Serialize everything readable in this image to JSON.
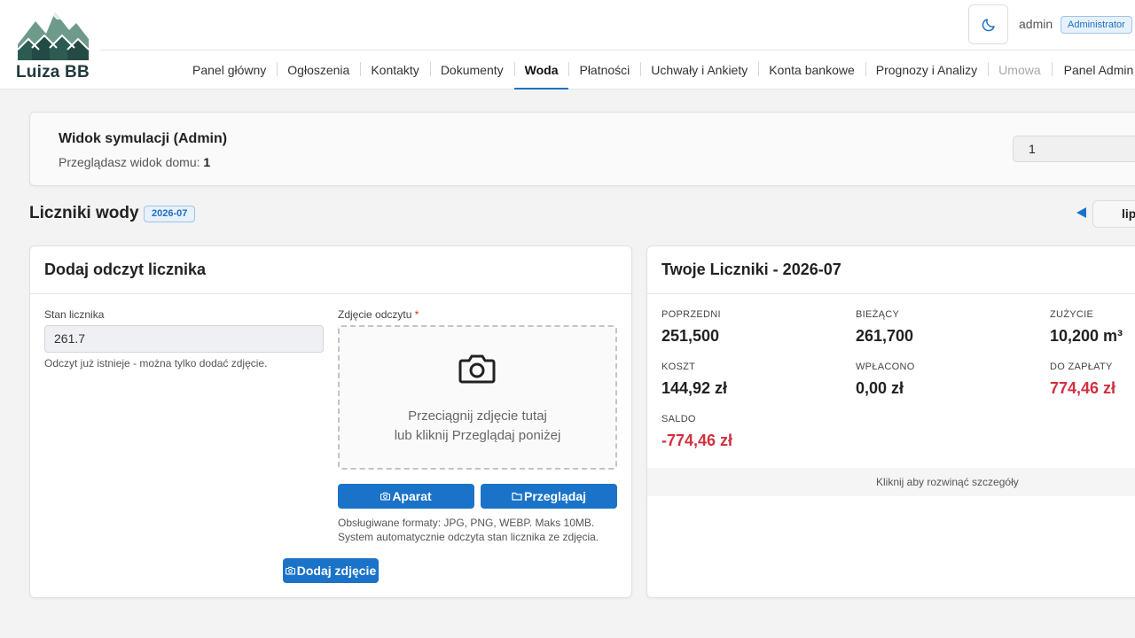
{
  "app": {
    "logo_text": "Luiza BB",
    "logo_icon": "mountain-houses-logo"
  },
  "header": {
    "theme_icon": "moon-icon",
    "user_name": "admin",
    "role_badge": "Administrator"
  },
  "nav": {
    "items": [
      {
        "label": "Panel główny"
      },
      {
        "label": "Ogłoszenia"
      },
      {
        "label": "Kontakty"
      },
      {
        "label": "Dokumenty"
      },
      {
        "label": "Woda",
        "active": true
      },
      {
        "label": "Płatności"
      },
      {
        "label": "Uchwały i Ankiety"
      },
      {
        "label": "Konta bankowe"
      },
      {
        "label": "Prognozy i Analizy"
      },
      {
        "label": "Umowa",
        "disabled": true
      },
      {
        "label": "Panel Admin"
      }
    ]
  },
  "simulation": {
    "title": "Widok symulacji (Admin)",
    "subtitle_prefix": "Przeglądasz widok domu:",
    "house": "1",
    "select_value": "1"
  },
  "section": {
    "title": "Liczniki wody",
    "month_badge": "2026-07",
    "prev_icon": "triangle-left-icon",
    "month_button": "lip"
  },
  "add_reading": {
    "title": "Dodaj odczyt licznika",
    "meter_label": "Stan licznika",
    "meter_value": "261.7",
    "meter_hint": "Odczyt już istnieje - można tylko dodać zdjęcie.",
    "photo_label": "Zdjęcie odczytu",
    "required_mark": "*",
    "dropzone_icon": "camera-icon",
    "dropzone_line1": "Przeciągnij zdjęcie tutaj",
    "dropzone_line2": "lub kliknij Przeglądaj poniżej",
    "camera_button": "Aparat",
    "browse_button": "Przeglądaj",
    "formats_line1": "Obsługiwane formaty: JPG, PNG, WEBP. Maks 10MB.",
    "formats_line2": "System automatycznie odczyta stan licznika ze zdjęcia.",
    "add_photo_button": "Dodaj zdjęcie"
  },
  "meters": {
    "title": "Twoje Liczniki - 2026-07",
    "stats": [
      {
        "label": "Poprzedni",
        "value": "251,500"
      },
      {
        "label": "Bieżący",
        "value": "261,700"
      },
      {
        "label": "Zużycie",
        "value": "10,200 m³"
      },
      {
        "label": "Koszt",
        "value": "144,92 zł"
      },
      {
        "label": "Wpłacono",
        "value": "0,00 zł"
      },
      {
        "label": "Do zapłaty",
        "value": "774,46 zł",
        "color": "#d32f3f"
      },
      {
        "label": "Saldo",
        "value": "-774,46 zł",
        "color": "#d32f3f"
      }
    ],
    "expand_text": "Kliknij aby rozwinąć szczegóły"
  }
}
